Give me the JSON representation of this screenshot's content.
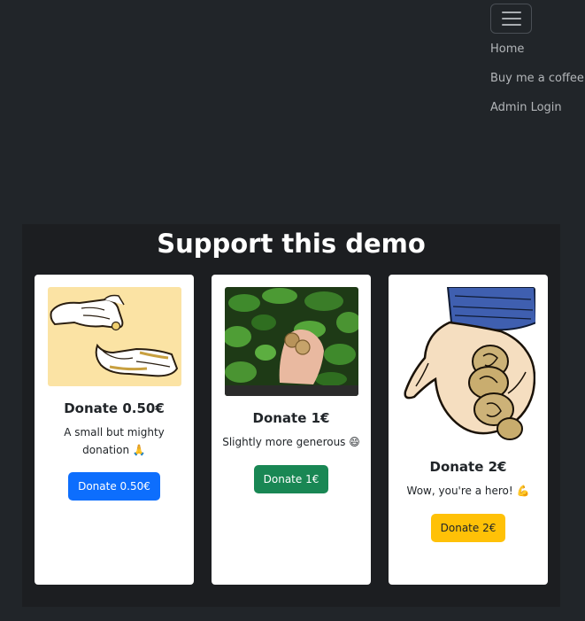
{
  "nav": {
    "items": [
      {
        "label": "Home"
      },
      {
        "label": "Buy me a coffee"
      },
      {
        "label": "Admin Login"
      }
    ]
  },
  "section": {
    "title": "Support this demo"
  },
  "cards": [
    {
      "title": "Donate 0.50€",
      "text": "A small but mighty donation 🙏",
      "button": "Donate 0.50€",
      "button_color": "#0d6efd",
      "button_text_color": "#ffffff",
      "image_icon": "giving-hands-icon"
    },
    {
      "title": "Donate 1€",
      "text": "Slightly more generous 😄",
      "button": "Donate 1€",
      "button_color": "#198754",
      "button_text_color": "#ffffff",
      "image_icon": "coins-in-hand-photo"
    },
    {
      "title": "Donate 2€",
      "text": "Wow, you're a hero! 💪",
      "button": "Donate 2€",
      "button_color": "#ffc107",
      "button_text_color": "#212529",
      "image_icon": "hand-with-coins-icon"
    }
  ]
}
